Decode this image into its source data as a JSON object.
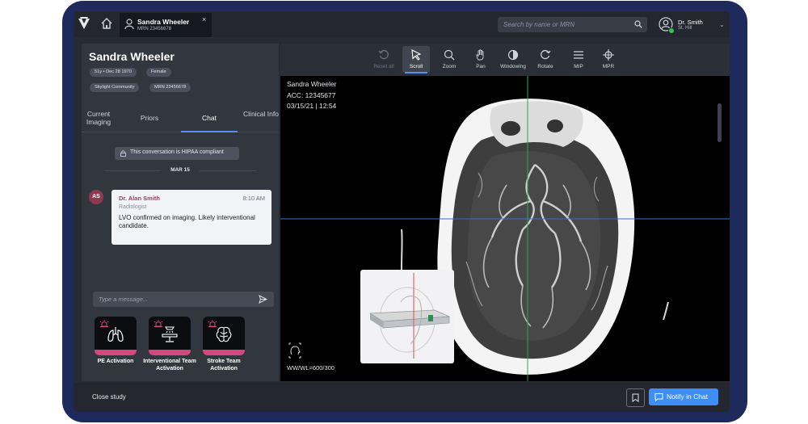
{
  "header": {
    "patient_tab": {
      "name": "Sandra Wheeler",
      "mrn": "MRN 23456678",
      "close_glyph": "×"
    },
    "search_placeholder": "Search by name or MRN",
    "user": {
      "name": "Dr. Smith",
      "location": "St. Hill"
    }
  },
  "patient": {
    "name": "Sandra Wheeler",
    "badges": [
      "51y • Dec 28 1970",
      "Female",
      "Skylight Community",
      "MRN 23456678"
    ]
  },
  "tabs": [
    {
      "label": "Current Imaging"
    },
    {
      "label": "Priors"
    },
    {
      "label": "Chat",
      "active": true
    },
    {
      "label": "Clinical Info"
    }
  ],
  "chat": {
    "hipaa_notice": "This conversation is HIPAA compliant",
    "date_divider": "MAR 15",
    "messages": [
      {
        "initials": "AS",
        "author": "Dr. Alan Smith",
        "role": "Radiologist",
        "time": "8:10 AM",
        "text": "LVO confirmed on imaging. Likely interventional candidate."
      }
    ],
    "input_placeholder": "Type a message..."
  },
  "activations": [
    {
      "label": "PE Activation",
      "icon": "lungs-icon"
    },
    {
      "label": "Interventional Team Activation",
      "icon": "surgical-table-icon"
    },
    {
      "label": "Stroke Team Activation",
      "icon": "brain-icon"
    }
  ],
  "toolbar": {
    "tools": [
      {
        "label": "Reset all",
        "icon": "reset-icon",
        "disabled": true
      },
      {
        "label": "Scroll",
        "icon": "cursor-icon",
        "active": true
      },
      {
        "label": "Zoom",
        "icon": "zoom-icon"
      },
      {
        "label": "Pan",
        "icon": "hand-icon"
      },
      {
        "label": "Windowing",
        "icon": "windowing-icon"
      },
      {
        "label": "Rotate",
        "icon": "rotate-icon"
      },
      {
        "label": "MIP",
        "icon": "mip-icon"
      },
      {
        "label": "MPR",
        "icon": "mpr-icon"
      }
    ]
  },
  "viewer": {
    "patient_name": "Sandra Wheeler",
    "acc": "ACC: 12345677",
    "datetime": "03/15/21 | 12:54",
    "window_level": "WW/WL=600/300"
  },
  "footer": {
    "close_label": "Close study",
    "notify_label": "Notify in Chat"
  },
  "colors": {
    "accent": "#3f8ef5",
    "activation": "#d3487f",
    "author": "#a33d59",
    "crosshair": "#2f6fd6"
  }
}
